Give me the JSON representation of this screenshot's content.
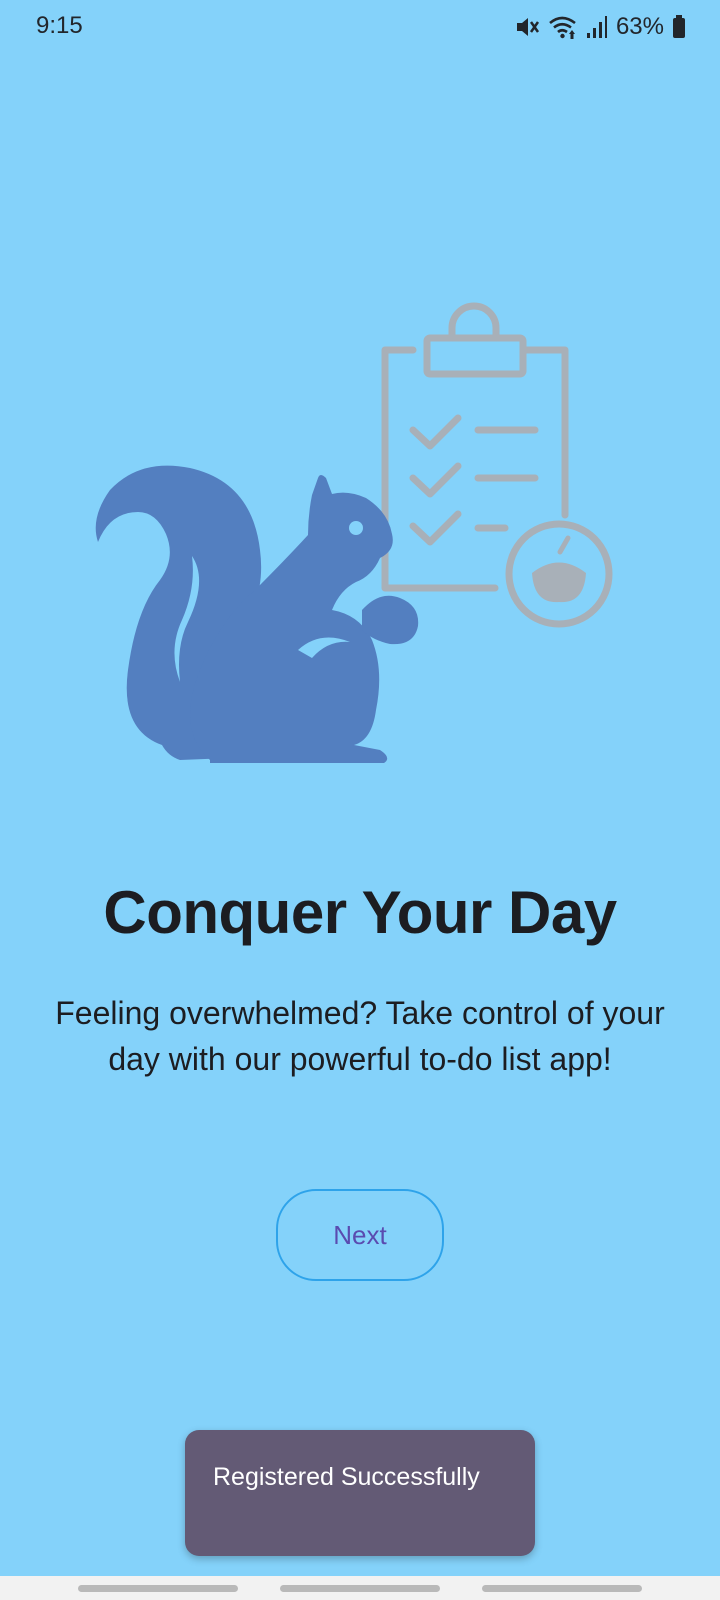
{
  "status_bar": {
    "time": "9:15",
    "battery_percent": "63%",
    "icons": [
      "mute-icon",
      "wifi-icon",
      "signal-icon",
      "battery-icon"
    ]
  },
  "illustration": {
    "icons": [
      "squirrel-icon",
      "clipboard-checklist-icon",
      "acorn-badge-icon"
    ],
    "colors": {
      "squirrel": "#537fc0",
      "clipboard": "#a8b0b8"
    }
  },
  "onboarding": {
    "title": "Conquer Your Day",
    "description": "Feeling overwhelmed? Take control of your day with our powerful to-do list app!",
    "next_label": "Next"
  },
  "toast": {
    "message": "Registered Successfully"
  },
  "colors": {
    "background": "#84d2fa",
    "button_border": "#2ea3ea",
    "button_text": "#5a4bb0",
    "toast_background": "#635a75"
  }
}
